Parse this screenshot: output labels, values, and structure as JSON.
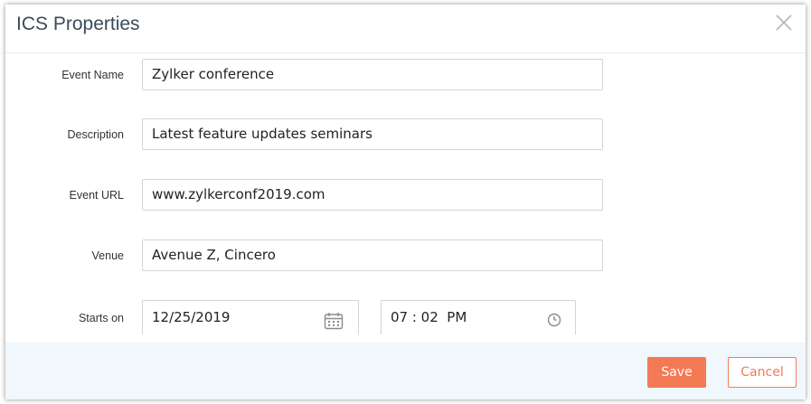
{
  "dialog": {
    "title": "ICS Properties"
  },
  "form": {
    "event_name": {
      "label": "Event Name",
      "value": "Zylker conference"
    },
    "description": {
      "label": "Description",
      "value": "Latest feature updates seminars"
    },
    "event_url": {
      "label": "Event URL",
      "value": "www.zylkerconf2019.com"
    },
    "venue": {
      "label": "Venue",
      "value": "Avenue Z, Cincero"
    },
    "starts_on": {
      "label": "Starts on",
      "date": "12/25/2019",
      "time": "07 : 02  PM",
      "date_icon": "calendar-icon",
      "time_icon": "clock-icon"
    }
  },
  "footer": {
    "save_label": "Save",
    "cancel_label": "Cancel"
  },
  "colors": {
    "accent": "#f47a55",
    "footer_bg": "#f0f7fd",
    "title": "#3b4a5a"
  }
}
